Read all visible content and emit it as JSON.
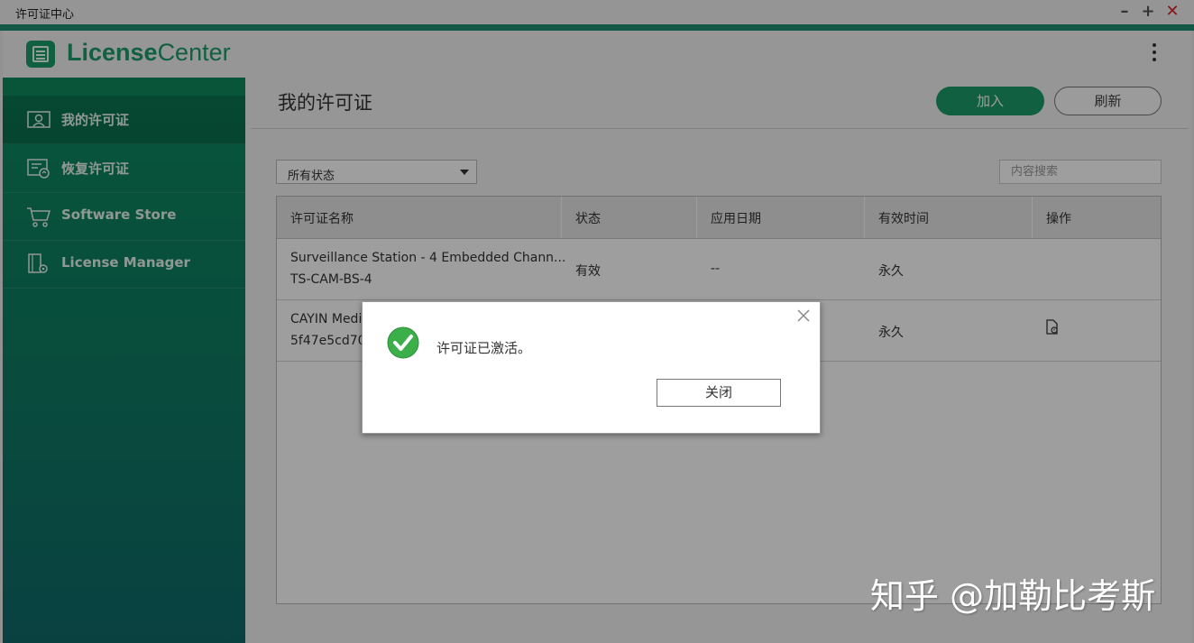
{
  "window": {
    "title": "许可证中心"
  },
  "header": {
    "brand_bold": "License",
    "brand_light": "Center"
  },
  "sidebar": {
    "items": [
      {
        "label": "我的许可证",
        "icon": "id-card-icon",
        "active": true
      },
      {
        "label": "恢复许可证",
        "icon": "restore-license-icon"
      },
      {
        "label": "Software Store",
        "icon": "cart-icon"
      },
      {
        "label": "License Manager",
        "icon": "license-manager-icon"
      }
    ]
  },
  "main": {
    "title": "我的许可证",
    "add_label": "加入",
    "refresh_label": "刷新",
    "filter_value": "所有状态",
    "search_placeholder": "内容搜索",
    "columns": [
      "许可证名称",
      "状态",
      "应用日期",
      "有效时间",
      "操作"
    ],
    "rows": [
      {
        "name": "Surveillance Station - 4 Embedded Chann...",
        "key": "TS-CAM-BS-4",
        "status": "有效",
        "date": "--",
        "validity": "永久"
      },
      {
        "name": "CAYIN Medi",
        "key": "5f47e5cd70",
        "status": "",
        "date": "",
        "validity": "永久",
        "action_icon": "license-file-icon"
      }
    ]
  },
  "dialog": {
    "message": "许可证已激活。",
    "close_label": "关闭"
  },
  "watermark": "知乎 @加勒比考斯",
  "colors": {
    "accent": "#1a9b6a",
    "sidebar": "#0f7a63",
    "close_red": "#d9252a"
  }
}
